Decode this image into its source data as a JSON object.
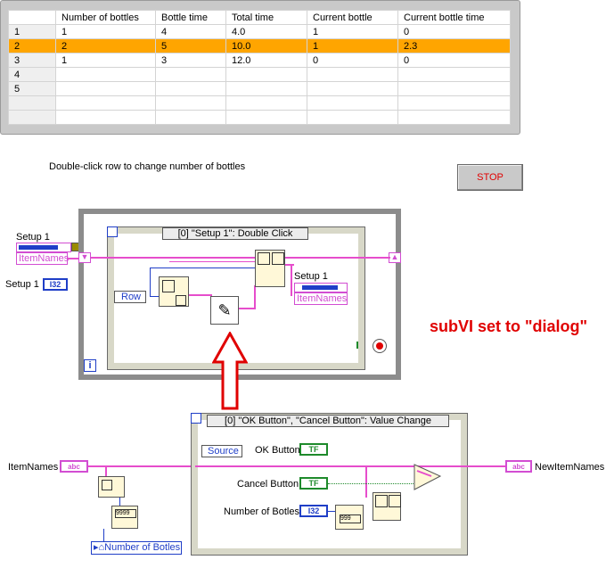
{
  "table": {
    "headers": [
      "",
      "Number of bottles",
      "Bottle time",
      "Total time",
      "Current bottle",
      "Current bottle time"
    ],
    "rows": [
      [
        "1",
        "1",
        "4",
        "4.0",
        "1",
        "0"
      ],
      [
        "2",
        "2",
        "5",
        "10.0",
        "1",
        "2.3"
      ],
      [
        "3",
        "1",
        "3",
        "12.0",
        "0",
        "0"
      ],
      [
        "4",
        "",
        "",
        "",
        "",
        ""
      ],
      [
        "5",
        "",
        "",
        "",
        "",
        ""
      ],
      [
        "",
        "",
        "",
        "",
        "",
        ""
      ],
      [
        "",
        "",
        "",
        "",
        "",
        ""
      ]
    ],
    "selected_row": 2,
    "selected_color": "#ffa500"
  },
  "hint_text": "Double-click row to change number of bottles",
  "stop_label": "STOP",
  "top_diagram": {
    "setup_label": "Setup 1",
    "itemnames_label": "ItemNames",
    "setup_i32_label": "Setup 1",
    "i32_text": "I32",
    "event_selector": "[0] \"Setup 1\": Double Click",
    "row_terminal": "Row",
    "inner_setup_label": "Setup 1",
    "inner_itemnames_label": "ItemNames",
    "loop_iteration": "i",
    "wire_color": "#e64dcc"
  },
  "annotation": {
    "text": "subVI set to \"dialog\"",
    "color": "#e00000"
  },
  "bottom_diagram": {
    "itemnames_label": "ItemNames",
    "abc_text": "abc",
    "event_selector": "[0] \"OK Button\", \"Cancel Button\": Value Change",
    "source_label": "Source",
    "ok_label": "OK Button",
    "cancel_label": "Cancel Button",
    "number_label": "Number of Botles",
    "tf_text": "TF",
    "i32_text": "I32",
    "new_itemnames_label": "NewItemNames",
    "property_label": "Number of Botles",
    "format_text": "9999",
    "format_text2": "999"
  }
}
